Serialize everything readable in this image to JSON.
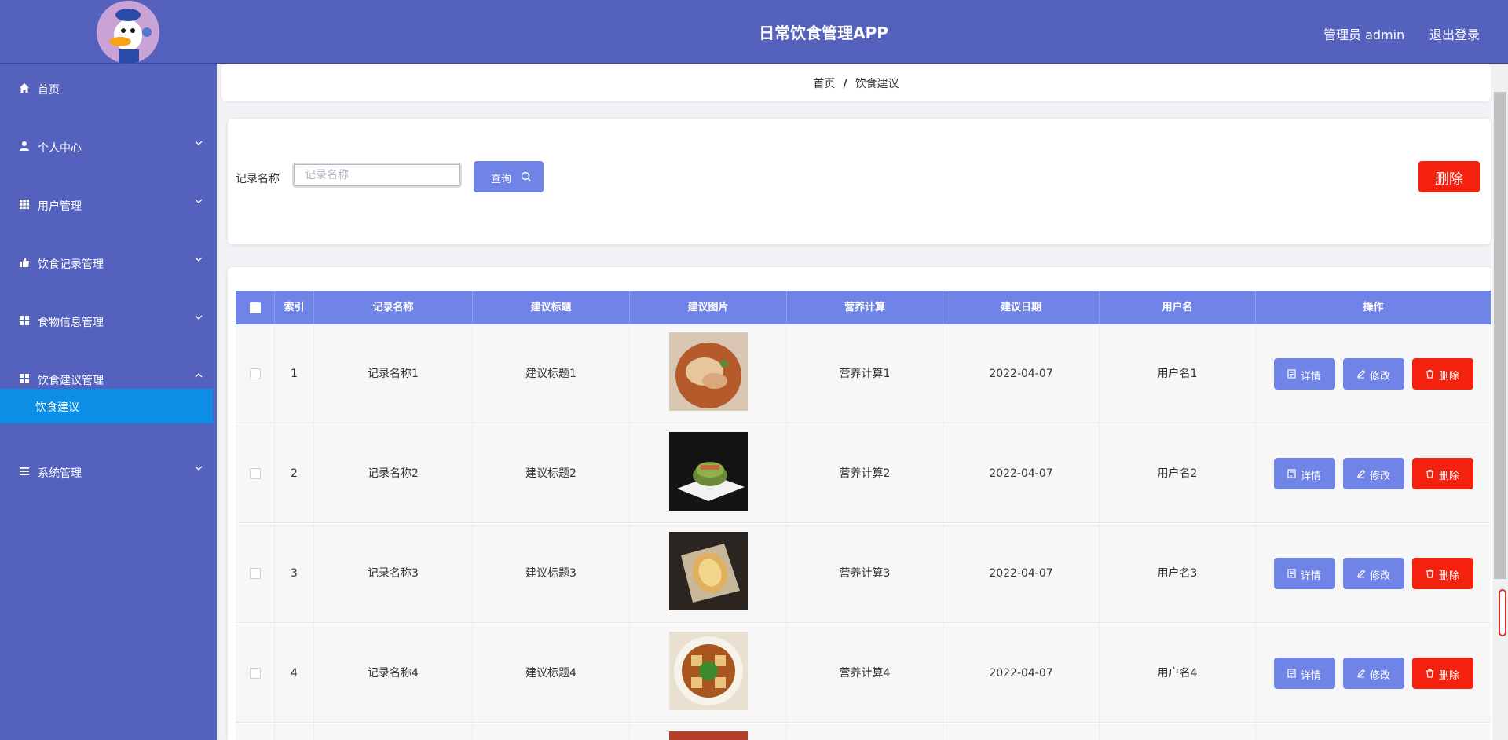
{
  "header": {
    "title": "日常饮食管理APP",
    "user_label": "管理员 admin",
    "logout_label": "退出登录",
    "bg_color": "#5461bd"
  },
  "sidebar": {
    "items": [
      {
        "label": "首页",
        "icon": "home-icon"
      },
      {
        "label": "个人中心",
        "icon": "user-icon"
      },
      {
        "label": "用户管理",
        "icon": "grid-icon"
      },
      {
        "label": "饮食记录管理",
        "icon": "thumb-icon"
      },
      {
        "label": "食物信息管理",
        "icon": "apps-icon"
      },
      {
        "label": "饮食建议管理",
        "icon": "apps-icon"
      },
      {
        "label": "系统管理",
        "icon": "menu-icon"
      }
    ],
    "active_sub": "饮食建议"
  },
  "breadcrumb": {
    "home": "首页",
    "separator": "/",
    "current": "饮食建议"
  },
  "search": {
    "label": "记录名称",
    "placeholder": "记录名称",
    "value": "",
    "button_label": "查询",
    "delete_label": "删除"
  },
  "table": {
    "columns": [
      "索引",
      "记录名称",
      "建议标题",
      "建议图片",
      "营养计算",
      "建议日期",
      "用户名",
      "操作"
    ],
    "rows": [
      {
        "index": "1",
        "record": "记录名称1",
        "title": "建议标题1",
        "image": "noodle-dish-image",
        "nutrition": "营养计算1",
        "date": "2022-04-07",
        "user": "用户名1"
      },
      {
        "index": "2",
        "record": "记录名称2",
        "title": "建议标题2",
        "image": "green-dish-image",
        "nutrition": "营养计算2",
        "date": "2022-04-07",
        "user": "用户名2"
      },
      {
        "index": "3",
        "record": "记录名称3",
        "title": "建议标题3",
        "image": "bread-dish-image",
        "nutrition": "营养计算3",
        "date": "2022-04-07",
        "user": "用户名3"
      },
      {
        "index": "4",
        "record": "记录名称4",
        "title": "建议标题4",
        "image": "tofu-dish-image",
        "nutrition": "营养计算4",
        "date": "2022-04-07",
        "user": "用户名4"
      }
    ],
    "actions": {
      "detail": "详情",
      "edit": "修改",
      "delete": "删除"
    }
  },
  "colors": {
    "accent": "#6f84e6",
    "danger": "#f4210e",
    "active_menu": "#0c8ee6"
  }
}
